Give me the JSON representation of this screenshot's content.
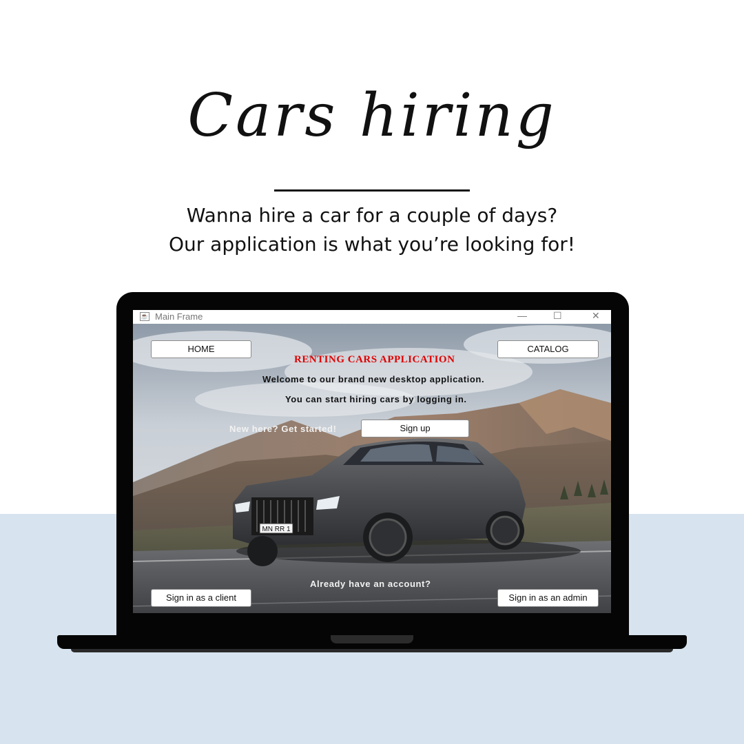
{
  "header": {
    "title": "Cars hiring",
    "tagline_line1": "Wanna hire a car for a couple of days?",
    "tagline_line2": "Our application is what you’re looking for!"
  },
  "window": {
    "title": "Main Frame",
    "controls": [
      "—",
      "☐",
      "✕"
    ]
  },
  "app": {
    "home_button": "HOME",
    "app_title": "RENTING CARS APPLICATION",
    "catalog_button": "CATALOG",
    "welcome_text": "Welcome to our brand new desktop application.",
    "start_text": "You can start hiring cars by logging in.",
    "new_here_text": "New here? Get started!",
    "signup_button": "Sign up",
    "account_text": "Already have an account?",
    "client_signin_button": "Sign in as a client",
    "admin_signin_button": "Sign in as an admin",
    "license_plate": "MN RR 1"
  },
  "colors": {
    "accent_red": "#e00000",
    "bottom_band": "#d7e4ef"
  }
}
